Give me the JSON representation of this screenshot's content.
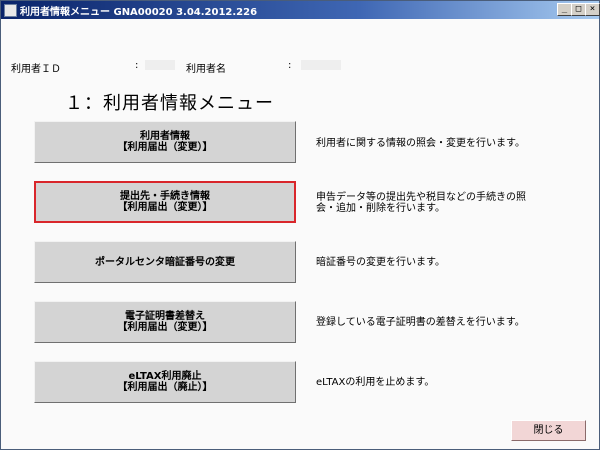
{
  "window": {
    "title": "利用者情報メニュー GNA00020 3.04.2012.226",
    "min_symbol": "_",
    "max_symbol": "□",
    "close_symbol": "×"
  },
  "user_info": {
    "id_label": "利用者ＩＤ",
    "id_separator": ":",
    "name_label": "利用者名",
    "name_separator": ":"
  },
  "heading": "１：利用者情報メニュー",
  "menu": [
    {
      "line1": "利用者情報",
      "line2": "【利用届出（変更）】",
      "desc1": "利用者に関する情報の照会・変更を行います。",
      "desc2": ""
    },
    {
      "line1": "提出先・手続き情報",
      "line2": "【利用届出（変更）】",
      "desc1": "申告データ等の提出先や税目などの手続きの照",
      "desc2": "会・追加・削除を行います。"
    },
    {
      "line1": "ポータルセンタ暗証番号の変更",
      "line2": "",
      "desc1": "暗証番号の変更を行います。",
      "desc2": ""
    },
    {
      "line1": "電子証明書差替え",
      "line2": "【利用届出（変更）】",
      "desc1": "登録している電子証明書の差替えを行います。",
      "desc2": ""
    },
    {
      "line1": "eLTAX利用廃止",
      "line2": "【利用届出（廃止）】",
      "desc1": "eLTAXの利用を止めます。",
      "desc2": ""
    }
  ],
  "close_button": "閉じる",
  "colors": {
    "selected_border": "#d9262b",
    "titlebar": "#0a246a",
    "close_bg": "#f2d6d6"
  }
}
